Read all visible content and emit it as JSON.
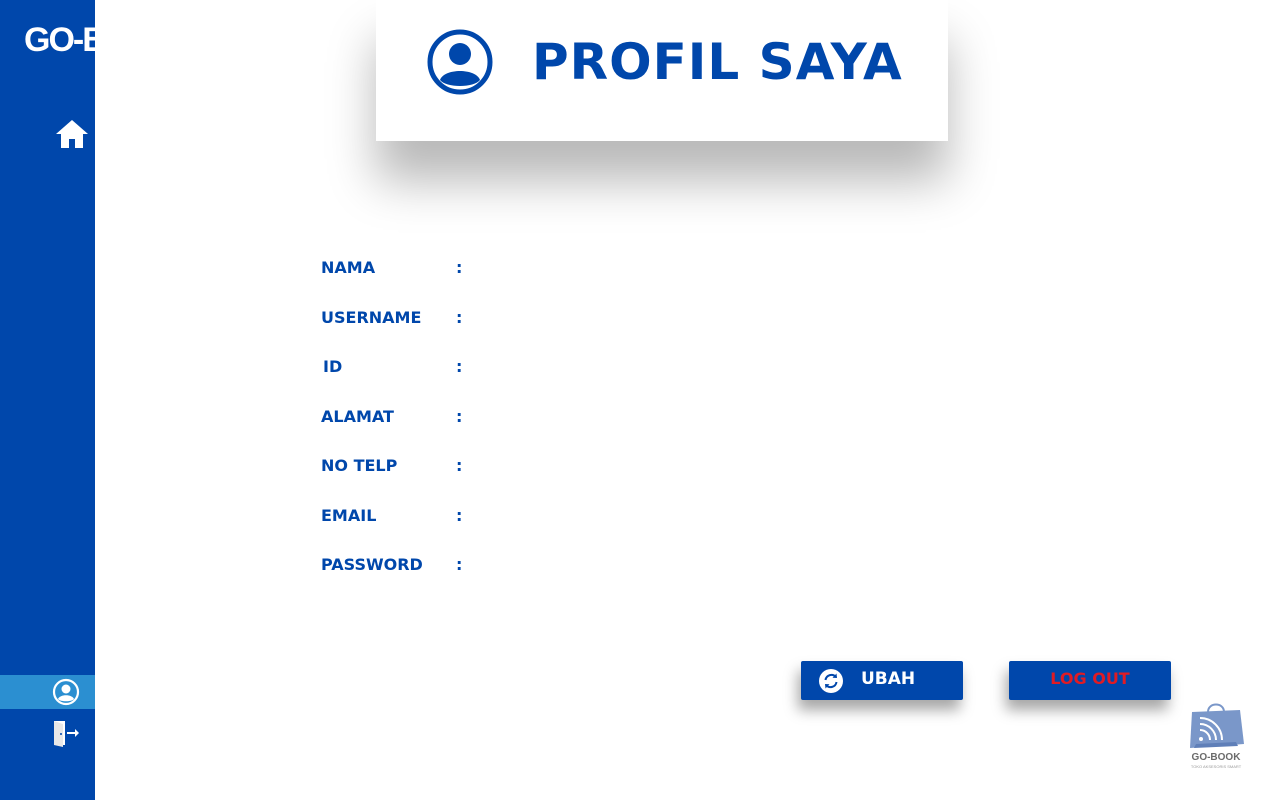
{
  "app": {
    "logo_text": "GO-BOOK",
    "brand_color": "#0047ab",
    "sidebar_active_color": "#2b8fd1"
  },
  "sidebar": {
    "items": [
      {
        "icon": "home-icon",
        "active": false
      },
      {
        "icon": "user-circle-icon",
        "active": true
      },
      {
        "icon": "logout-door-icon",
        "active": false
      }
    ]
  },
  "header": {
    "title": "PROFIL SAYA",
    "icon": "user-circle-icon"
  },
  "profile": {
    "fields": [
      {
        "label": "NAMA",
        "colon": ":",
        "value": ""
      },
      {
        "label": "USERNAME",
        "colon": ":",
        "value": ""
      },
      {
        "label": "ID",
        "colon": ":",
        "value": ""
      },
      {
        "label": "ALAMAT",
        "colon": ":",
        "value": ""
      },
      {
        "label": "NO TELP",
        "colon": ":",
        "value": ""
      },
      {
        "label": "EMAIL",
        "colon": ":",
        "value": ""
      },
      {
        "label": "PASSWORD",
        "colon": ":",
        "value": ""
      }
    ]
  },
  "actions": {
    "edit_label": "UBAH",
    "edit_icon": "refresh-icon",
    "logout_label": "LOG OUT",
    "logout_text_color": "#e01b24"
  },
  "footer_logo": {
    "name": "GO-BOOK",
    "tagline": "TOKO AKSESORIS SMART",
    "icon": "shopping-bag-wifi-icon"
  }
}
